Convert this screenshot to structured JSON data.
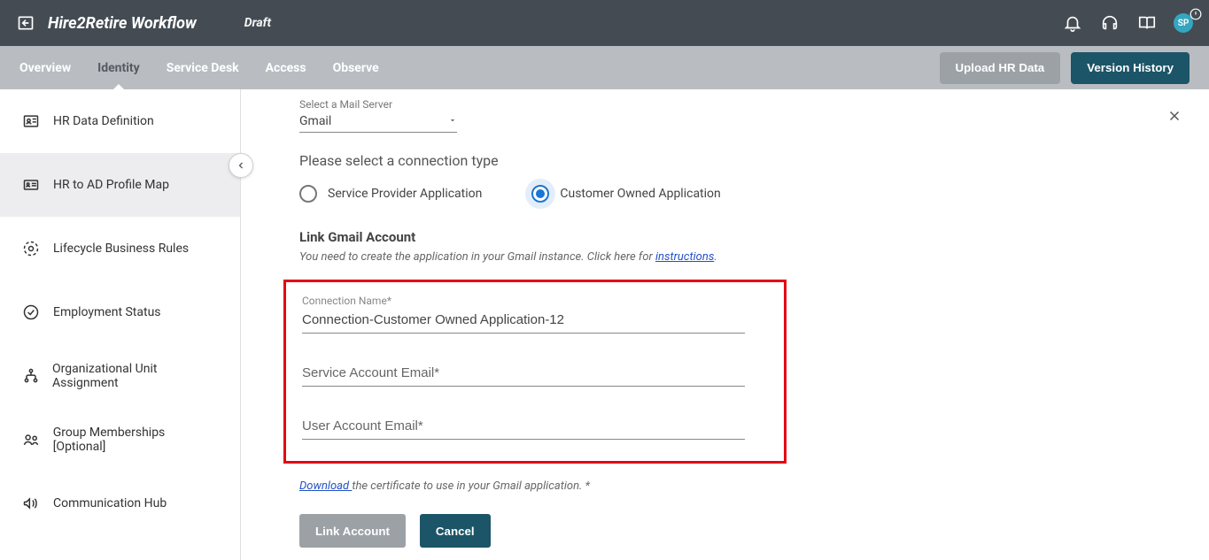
{
  "header": {
    "title": "Hire2Retire Workflow",
    "draft_label": "Draft",
    "avatar_initials": "SP"
  },
  "tabs": {
    "items": [
      "Overview",
      "Identity",
      "Service Desk",
      "Access",
      "Observe"
    ],
    "upload_label": "Upload HR Data",
    "version_label": "Version History"
  },
  "sidebar": {
    "items": [
      {
        "label": "HR Data Definition"
      },
      {
        "label": "HR to AD Profile Map"
      },
      {
        "label": "Lifecycle Business Rules"
      },
      {
        "label": "Employment Status"
      },
      {
        "label": "Organizational Unit Assignment"
      },
      {
        "label": "Group Memberships [Optional]"
      },
      {
        "label": "Communication Hub"
      }
    ]
  },
  "form": {
    "mail_server_label": "Select a Mail Server",
    "mail_server_value": "Gmail",
    "conn_type_title": "Please select a connection type",
    "radio_spa": "Service Provider Application",
    "radio_coa": "Customer Owned Application",
    "link_heading": "Link Gmail Account",
    "link_hint_pre": "You need to create the application in your Gmail instance. Click here for ",
    "link_hint_link": "instructions",
    "link_hint_post": ".",
    "conn_name_label": "Connection Name*",
    "conn_name_value": "Connection-Customer Owned Application-12",
    "svc_email_placeholder": "Service Account Email*",
    "user_email_placeholder": "User Account Email*",
    "download_link": "Download ",
    "download_text": "the certificate to use in your Gmail application. *",
    "btn_link": "Link Account",
    "btn_cancel": "Cancel"
  }
}
